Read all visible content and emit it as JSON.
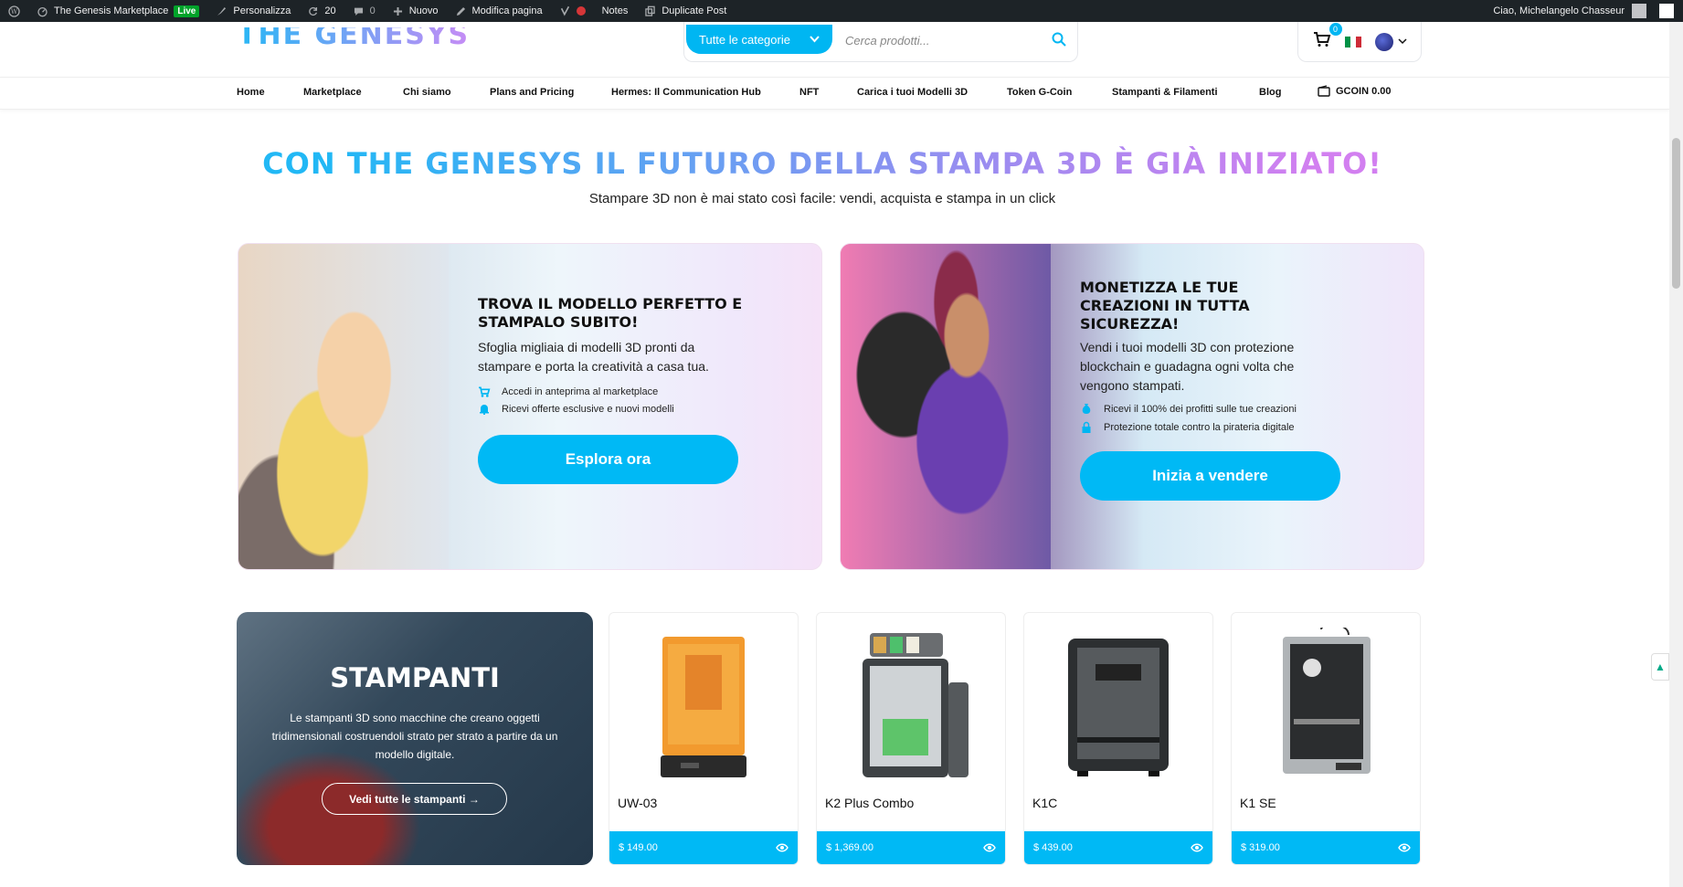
{
  "adminbar": {
    "site_name": "The Genesis Marketplace",
    "live": "Live",
    "customize": "Personalizza",
    "updates_count": "20",
    "comments_count": "0",
    "new": "Nuovo",
    "edit_page": "Modifica pagina",
    "notes": "Notes",
    "duplicate": "Duplicate Post",
    "greeting": "Ciao, Michelangelo Chasseur"
  },
  "header": {
    "logo": "THE GENESYS",
    "category_label": "Tutte le categorie",
    "search_placeholder": "Cerca prodotti...",
    "cart_count": "0"
  },
  "nav": {
    "items": [
      "Home",
      "Marketplace",
      "Chi siamo",
      "Plans and Pricing",
      "Hermes: Il Communication Hub",
      "NFT",
      "Carica i tuoi Modelli 3D",
      "Token G-Coin",
      "Stampanti & Filamenti",
      "Blog"
    ],
    "wallet": "GCOIN 0.00"
  },
  "hero": {
    "title": "CON THE GENESYS IL FUTURO DELLA STAMPA 3D È GIÀ INIZIATO!",
    "subtitle": "Stampare 3D non è mai stato così facile: vendi, acquista e stampa in un click"
  },
  "cards": [
    {
      "title": "TROVA IL MODELLO PERFETTO E STAMPALO SUBITO!",
      "desc": "Sfoglia migliaia di modelli 3D pronti da stampare e porta la creatività a casa tua.",
      "bullets": [
        "Accedi in anteprima al marketplace",
        "Ricevi offerte esclusive e nuovi modelli"
      ],
      "button": "Esplora ora"
    },
    {
      "title": "MONETIZZA LE TUE CREAZIONI IN TUTTA SICUREZZA!",
      "desc": "Vendi i tuoi modelli 3D con protezione blockchain e guadagna ogni volta che vengono stampati.",
      "bullets": [
        "Ricevi il 100% dei profitti sulle tue creazioni",
        "Protezione totale contro la pirateria digitale"
      ],
      "button": "Inizia a vendere"
    }
  ],
  "printers_section": {
    "title": "STAMPANTI",
    "desc": "Le stampanti 3D sono macchine che creano oggetti tridimensionali costruendoli strato per strato a partire da un modello digitale.",
    "button": "Vedi tutte le stampanti →"
  },
  "products": [
    {
      "name": "UW-03",
      "price": "$ 149.00"
    },
    {
      "name": "K2 Plus Combo",
      "price": "$ 1,369.00"
    },
    {
      "name": "K1C",
      "price": "$ 439.00"
    },
    {
      "name": "K1 SE",
      "price": "$ 319.00"
    }
  ],
  "colors": {
    "accent": "#00b9f5",
    "admin_bar": "#1d2327"
  }
}
